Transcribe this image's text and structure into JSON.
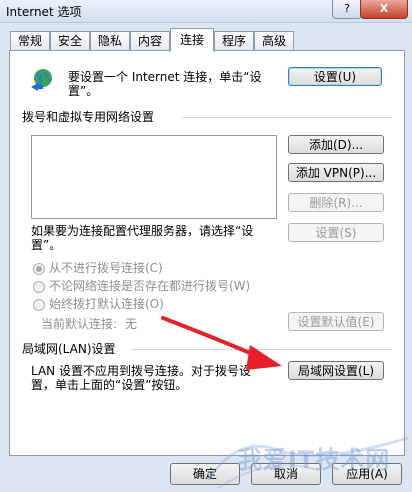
{
  "window": {
    "title": "Internet 选项",
    "help": "?",
    "close": "X"
  },
  "tabs": [
    {
      "label": "常规"
    },
    {
      "label": "安全"
    },
    {
      "label": "隐私"
    },
    {
      "label": "内容"
    },
    {
      "label": "连接",
      "active": true
    },
    {
      "label": "程序"
    },
    {
      "label": "高级"
    }
  ],
  "setup": {
    "text_line1": "要设置一个 Internet 连接，单击“设",
    "text_line2": "置”。",
    "button": "设置(U)",
    "icon": "globe-network-icon"
  },
  "dialup": {
    "heading": "拨号和虚拟专用网络设置",
    "add_button": "添加(D)...",
    "add_vpn_button": "添加 VPN(P)...",
    "delete_button": "删除(R)...",
    "proxy_text_line1": "如果要为连接配置代理服务器，请选择“设",
    "proxy_text_line2": "置”。",
    "settings_button": "设置(S)",
    "radio_never": "从不进行拨号连接(C)",
    "radio_when_no_network": "不论网络连接是否存在都进行拨号(W)",
    "radio_always": "始终拨打默认连接(O)",
    "current_default_label": "当前默认连接:",
    "current_default_value": "无",
    "set_default_button": "设置默认值(E)"
  },
  "lan": {
    "heading": "局域网(LAN)设置",
    "text_line1": "LAN 设置不应用到拨号连接。对于拨号设",
    "text_line2": "置，单击上面的“设置”按钮。",
    "button": "局域网设置(L)"
  },
  "footer": {
    "ok": "确定",
    "cancel": "取消",
    "apply": "应用(A)"
  },
  "watermark": {
    "text": "我爱IT技术网"
  },
  "colors": {
    "arrow": "#e8202a",
    "accent": "#3c7fb1"
  }
}
